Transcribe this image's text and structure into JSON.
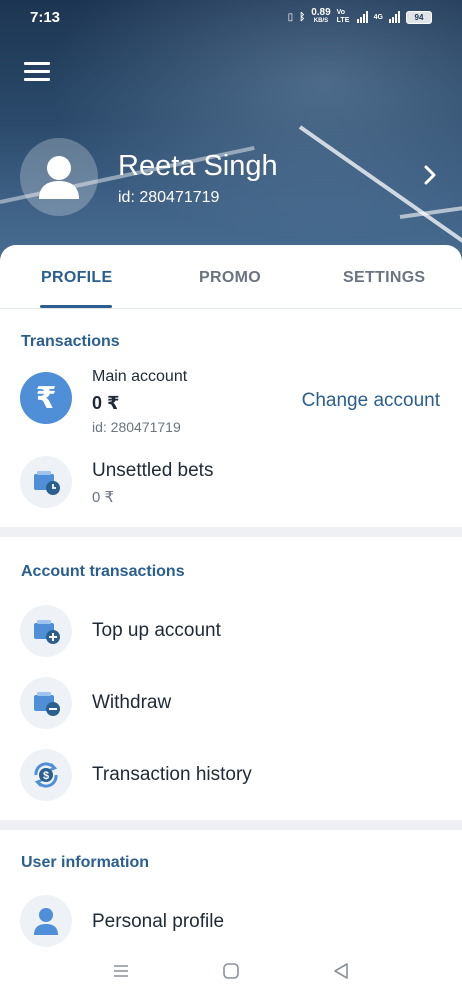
{
  "status_bar": {
    "time": "7:13",
    "speed": "0.89",
    "speed_unit": "KB/S",
    "volte": "Vo LTE",
    "network": "4G",
    "battery": "94"
  },
  "profile": {
    "name": "Reeta Singh",
    "id_label": "id: 280471719"
  },
  "tabs": [
    {
      "label": "PROFILE",
      "active": true
    },
    {
      "label": "PROMO",
      "active": false
    },
    {
      "label": "SETTINGS",
      "active": false
    }
  ],
  "transactions": {
    "title": "Transactions",
    "main_account": {
      "label": "Main account",
      "amount": "0 ₹",
      "id": "id: 280471719",
      "change_link": "Change account"
    },
    "unsettled": {
      "label": "Unsettled bets",
      "amount": "0 ₹"
    }
  },
  "account_transactions": {
    "title": "Account transactions",
    "items": [
      {
        "label": "Top up account",
        "icon": "wallet-plus-icon"
      },
      {
        "label": "Withdraw",
        "icon": "wallet-minus-icon"
      },
      {
        "label": "Transaction history",
        "icon": "dollar-refresh-icon"
      }
    ]
  },
  "user_information": {
    "title": "User information",
    "items": [
      {
        "label": "Personal profile",
        "icon": "person-icon"
      }
    ]
  },
  "colors": {
    "accent": "#2a5f8f",
    "icon_blue": "#4f8fd8",
    "icon_bg": "#eef2f7"
  }
}
